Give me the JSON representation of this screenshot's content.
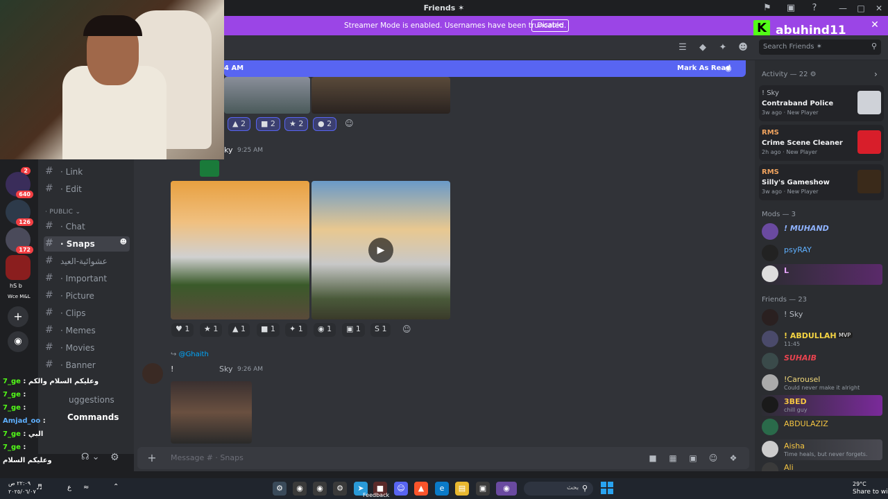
{
  "window": {
    "title": "Friends ✶"
  },
  "banner": {
    "text": "Streamer Mode is enabled. Usernames have been truncated.",
    "disable_label": "Disable",
    "kick_letter": "K",
    "kick_username": "abuhind11"
  },
  "header": {
    "search_placeholder": "Search Friends ✶"
  },
  "sidebar": {
    "top_channels": [
      {
        "label": "· Link"
      },
      {
        "label": "· Edit"
      }
    ],
    "category": "PUBLIC",
    "channels": [
      {
        "label": "· Chat"
      },
      {
        "label": "· Snaps"
      },
      {
        "label": "عشوائية-العيد"
      },
      {
        "label": "· Important"
      },
      {
        "label": "· Picture"
      },
      {
        "label": "· Clips"
      },
      {
        "label": "· Memes"
      },
      {
        "label": "· Movies"
      },
      {
        "label": "· Banner"
      },
      {
        "label": "uggestions"
      },
      {
        "label": "Commands"
      }
    ]
  },
  "rail": {
    "badges": [
      "2",
      "640",
      "126",
      "172"
    ],
    "labels": [
      "hS  b",
      "Wce M&L"
    ]
  },
  "main": {
    "new_messages_time": "4 AM",
    "mark_as_read": "Mark As Read",
    "reactions_top": [
      "2",
      "2",
      "2",
      "2"
    ],
    "msg1": {
      "author": "ky",
      "time": "9:25 AM"
    },
    "reactions_mid": [
      "1",
      "1",
      "1",
      "1",
      "1",
      "1",
      "1",
      "1"
    ],
    "msg2": {
      "reply_to": "@Ghaith",
      "text": "!",
      "author": "Sky",
      "time": "9:26 AM"
    },
    "composer_placeholder": "Message # · Snaps"
  },
  "activity": {
    "title": "Activity — 22",
    "cards": [
      {
        "who": "! Sky",
        "game": "Contraband Police",
        "meta": "3w ago  · New Player",
        "color": "#b5bac1"
      },
      {
        "who": "RMS",
        "game": "Crime Scene Cleaner",
        "meta": "2h ago  · New Player",
        "color": "#f0a35e"
      },
      {
        "who": "RMS",
        "game": "Silly's Gameshow",
        "meta": "3w ago  · New Player",
        "color": "#f0a35e"
      }
    ],
    "mods_title": "Mods — 3",
    "mods": [
      {
        "name": "! MUHAND",
        "status": "",
        "color": "#8fb3ff"
      },
      {
        "name": "psyRAY",
        "status": "",
        "color": "#5fb0ff"
      },
      {
        "name": "L",
        "status": "",
        "color": "#e8a6ff"
      }
    ],
    "friends_title": "Friends — 23",
    "friends": [
      {
        "name": "! Sky",
        "status": "",
        "color": "#b5bac1"
      },
      {
        "name": "! ABDULLAH",
        "status": "11:45",
        "color": "#f5d442"
      },
      {
        "name": "SUHAIB",
        "status": "",
        "color": "#e8434f"
      },
      {
        "name": "!Carousel",
        "status": "Could never make it alright",
        "color": "#f2d97a"
      },
      {
        "name": "3BED",
        "status": "chill guy",
        "color": "#f5c542"
      },
      {
        "name": "ABDULAZIZ",
        "status": "",
        "color": "#f5c542"
      },
      {
        "name": "Aisha",
        "status": "Time heals, but never forgets.",
        "color": "#f5c542"
      },
      {
        "name": "Ali",
        "status": "",
        "color": "#f5c542"
      }
    ],
    "mvp_label": "MVP"
  },
  "stream_chat": [
    {
      "user": "7_ge",
      "msg": "وعليكم السلام والكم",
      "color": "#53fc18"
    },
    {
      "user": "7_ge",
      "msg": "",
      "color": "#53fc18"
    },
    {
      "user": "7_ge",
      "msg": "",
      "color": "#53fc18"
    },
    {
      "user": "Amjad_oo",
      "msg": "",
      "color": "#5fb0ff"
    },
    {
      "user": "7_ge",
      "msg": "البي",
      "color": "#53fc18"
    },
    {
      "user": "7_ge",
      "msg": "",
      "color": "#53fc18"
    },
    {
      "user": "",
      "msg": "وعليكم السلام",
      "color": "#ffffff"
    }
  ],
  "taskbar": {
    "clock": "٢٢:٠٩ ص",
    "date": "٢٠٢٥/٠٦/٠٧",
    "lang": "ع",
    "search_label": "بحث",
    "temp": "29°C",
    "feedback": "Feedback",
    "share": "Share to wi"
  }
}
